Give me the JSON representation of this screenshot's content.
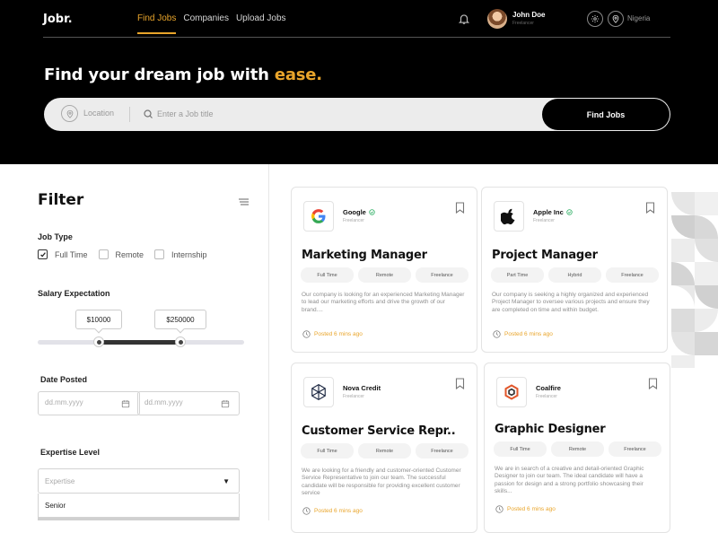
{
  "brand": {
    "logo": "Jobr.",
    "accent_color": "#e9a52b"
  },
  "nav": {
    "items": [
      {
        "label": "Find Jobs",
        "active": true
      },
      {
        "label": "Companies",
        "active": false
      },
      {
        "label": "Upload Jobs",
        "active": false
      }
    ]
  },
  "user": {
    "name": "John Doe",
    "role": "Freelancer",
    "country": "Nigeria"
  },
  "icons": {
    "notifications": "bell-icon",
    "settings": "gear-icon",
    "location": "map-pin-icon"
  },
  "hero": {
    "headline_start": "Find your dream job with ",
    "headline_accent": "ease."
  },
  "search": {
    "location_placeholder": "Location",
    "job_placeholder": "Enter a Job title",
    "button_label": "Find Jobs"
  },
  "filter": {
    "title": "Filter",
    "job_type": {
      "label": "Job Type",
      "options": [
        {
          "label": "Full Time",
          "checked": true
        },
        {
          "label": "Remote",
          "checked": false
        },
        {
          "label": "Internship",
          "checked": false
        }
      ]
    },
    "salary": {
      "label": "Salary Expectation",
      "min": "$10000",
      "max": "$250000"
    },
    "date_posted": {
      "label": "Date Posted",
      "from_placeholder": "dd.mm.yyyy",
      "to_placeholder": "dd.mm.yyyy"
    },
    "expertise": {
      "label": "Expertise Level",
      "selected": "Expertise",
      "options": [
        "Senior"
      ]
    }
  },
  "jobs": [
    {
      "company": "Google",
      "verified": true,
      "company_type": "Freelancer",
      "title": "Marketing Manager",
      "tags": [
        "Full Time",
        "Remote",
        "Freelance"
      ],
      "description": "Our company is looking for an experienced Marketing Manager to lead our marketing efforts and drive the growth of our brand....",
      "posted": "Posted 6 mins ago",
      "logo_icon": "google-logo-icon"
    },
    {
      "company": "Apple Inc",
      "verified": true,
      "company_type": "Freelancer",
      "title": "Project Manager",
      "tags": [
        "Part Time",
        "Hybrid",
        "Freelance"
      ],
      "description": "Our company is seeking a highly organized and experienced Project Manager to oversee various projects and ensure they are completed on time and within budget.",
      "posted": "Posted 6 mins ago",
      "logo_icon": "apple-logo-icon"
    },
    {
      "company": "Nova Credit",
      "verified": false,
      "company_type": "Freelancer",
      "title": "Customer Service Repr..",
      "tags": [
        "Full Time",
        "Remote",
        "Freelance"
      ],
      "description": "We are looking for a friendly and customer-oriented Customer Service Representative to join our team. The successful candidate will be responsible for providing excellent customer service",
      "posted": "Posted 6 mins ago",
      "logo_icon": "nova-credit-logo-icon"
    },
    {
      "company": "Coalfire",
      "verified": false,
      "company_type": "Freelancer",
      "title": "Graphic Designer",
      "tags": [
        "Full Time",
        "Remote",
        "Freelance"
      ],
      "description": "We are in search of a creative and detail-oriented Graphic Designer to join our team. The ideal candidate will have a passion for design and a strong portfolio showcasing their skills...",
      "posted": "Posted 6 mins ago",
      "logo_icon": "coalfire-logo-icon"
    }
  ]
}
